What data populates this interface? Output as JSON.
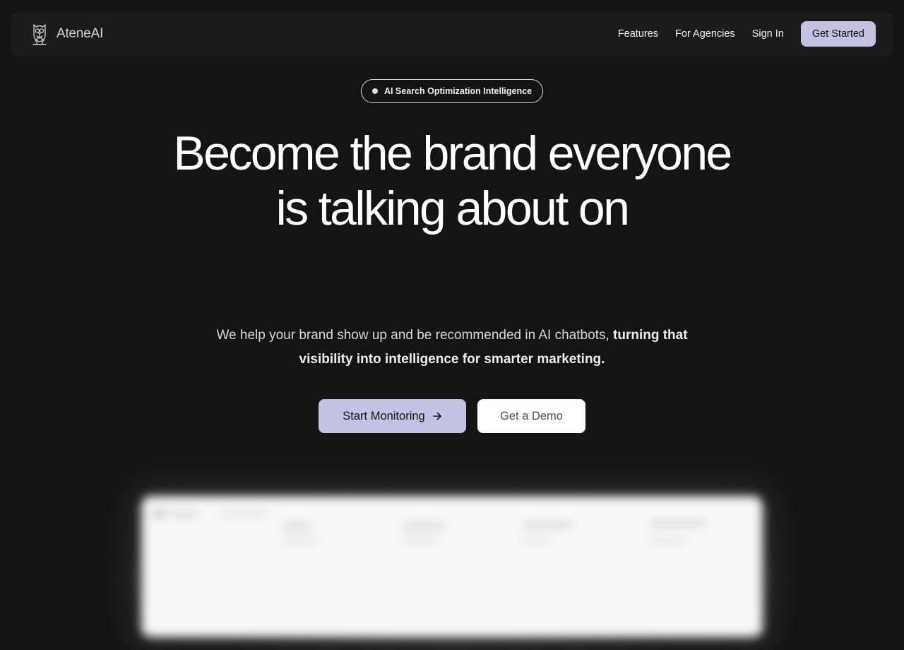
{
  "navbar": {
    "brand": "AteneAI",
    "logo_icon": "owl-icon",
    "links": [
      {
        "label": "Features"
      },
      {
        "label": "For Agencies"
      },
      {
        "label": "Sign In"
      }
    ],
    "cta_label": "Get Started"
  },
  "hero": {
    "badge": "AI Search Optimization Intelligence",
    "headline_line1": "Become the brand everyone",
    "headline_line2": "is talking about on",
    "subtext_regular": "We help your brand show up and be recommended in AI chatbots, ",
    "subtext_bold": "turning that visibility into intelligence for smarter marketing.",
    "primary_cta": "Start Monitoring",
    "primary_cta_icon": "arrow-right-icon",
    "secondary_cta": "Get a Demo"
  },
  "colors": {
    "background": "#141414",
    "navbar_background": "#1b1b1b",
    "accent": "#c4c2e2",
    "text": "#ffffff"
  }
}
